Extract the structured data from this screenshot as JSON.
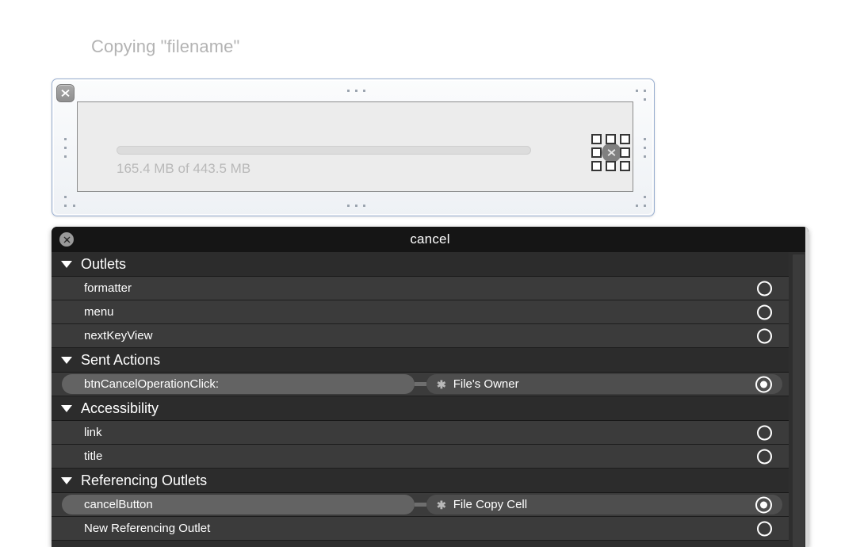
{
  "canvas": {
    "close_button_icon": "close-x-icon",
    "cell": {
      "title": "Copying \"filename\"",
      "progress_percent": 0,
      "subtitle": "165.4 MB of 443.5 MB",
      "cancel_button_icon": "cancel-x-icon"
    },
    "guide_dot_icon": "layout-guide-dot"
  },
  "hud": {
    "title": "cancel",
    "close_button_icon": "close-x-icon",
    "sections": [
      {
        "id": "outlets",
        "label": "Outlets",
        "disclosure_icon": "triangle-down-icon",
        "rows": [
          {
            "type": "plain",
            "label": "formatter",
            "connected": false
          },
          {
            "type": "plain",
            "label": "menu",
            "connected": false
          },
          {
            "type": "plain",
            "label": "nextKeyView",
            "connected": false
          }
        ]
      },
      {
        "id": "sent-actions",
        "label": "Sent Actions",
        "disclosure_icon": "triangle-down-icon",
        "rows": [
          {
            "type": "connected",
            "label": "btnCancelOperationClick:",
            "target": "File's Owner",
            "target_icon": "asterisk-icon",
            "connected": true
          }
        ]
      },
      {
        "id": "accessibility",
        "label": "Accessibility",
        "disclosure_icon": "triangle-down-icon",
        "rows": [
          {
            "type": "plain",
            "label": "link",
            "connected": false
          },
          {
            "type": "plain",
            "label": "title",
            "connected": false
          }
        ]
      },
      {
        "id": "referencing-outlets",
        "label": "Referencing Outlets",
        "disclosure_icon": "triangle-down-icon",
        "rows": [
          {
            "type": "connected",
            "label": "cancelButton",
            "target": "File Copy Cell",
            "target_icon": "asterisk-icon",
            "connected": true
          },
          {
            "type": "plain",
            "label": "New Referencing Outlet",
            "connected": false
          }
        ]
      }
    ],
    "scrollbar_name": "vertical-scrollbar"
  },
  "colors": {
    "hud_bg": "#2e2e2e",
    "hud_titlebar": "#151515",
    "row_item": "#3b3b3b",
    "row_header": "#2c2c2c",
    "pill_source": "#636363",
    "pill_target": "#4e4e4e",
    "canvas_border": "#9bb0d0",
    "cell_bg": "#ececec",
    "cell_text": "#b3b3b3"
  }
}
